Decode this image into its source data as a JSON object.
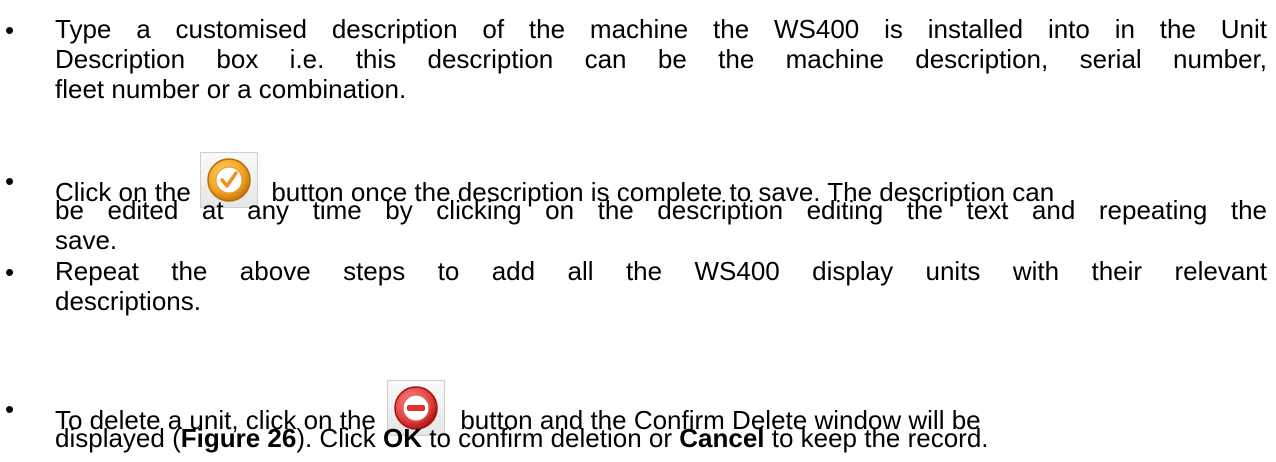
{
  "bullets": {
    "b1": {
      "l1": "Type a customised description of the machine the WS400 is installed into in the Unit",
      "l2": "Description box i.e. this description can be the machine description, serial number,",
      "l3": "fleet number or a combination."
    },
    "b2": {
      "l1a": "Click on the",
      "l1b": "button once the description is complete to save. The description can",
      "l2": "be edited at any time by clicking on the description editing the text and repeating the",
      "l3": "save.",
      "icon": "confirm-check-icon"
    },
    "b3": {
      "l1": "Repeat the above steps to add all the WS400 display units with their relevant",
      "l2": "descriptions."
    },
    "b4": {
      "l1a": "To delete a unit, click on the",
      "l1b": "button and the Confirm Delete window will be",
      "l2a": "displayed (",
      "l2b": "Figure 26",
      "l2c": "). Click ",
      "l2d": "OK",
      "l2e": " to confirm deletion or ",
      "l2f": "Cancel",
      "l2g": " to keep the record.",
      "icon": "delete-minus-icon"
    }
  },
  "colors": {
    "confirm_ring": "#f0a020",
    "delete_ring": "#e04040"
  }
}
